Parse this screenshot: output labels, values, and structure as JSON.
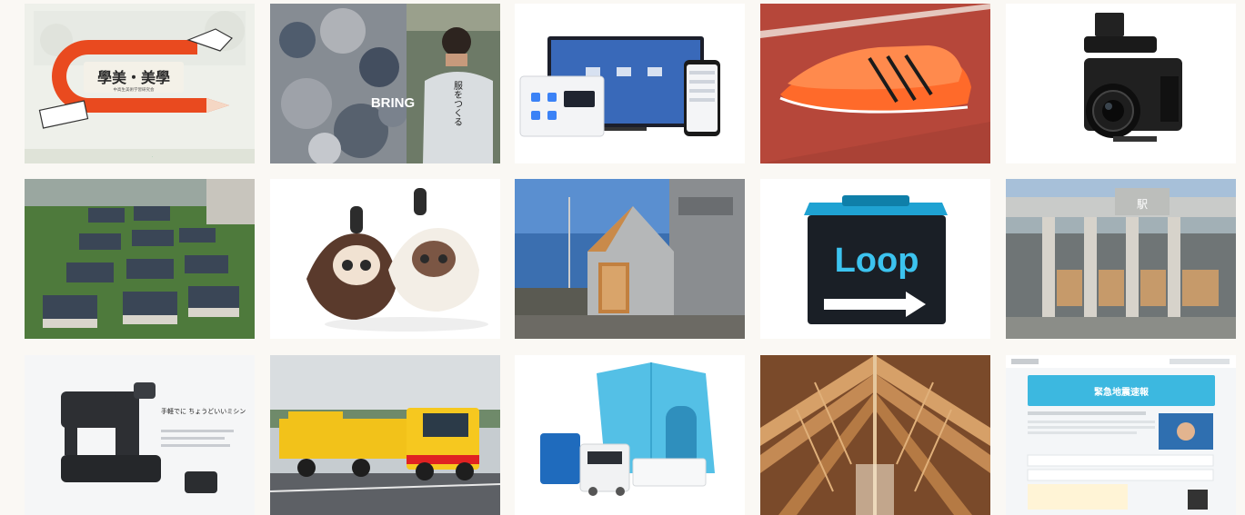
{
  "tiles": [
    {
      "id": "t1",
      "title": "學美・美學",
      "subtitle": "中高生美術学習研究会",
      "icon": "red-magnet-pencil-illustration"
    },
    {
      "id": "t2",
      "title": "BRING",
      "subtitle": "服をつくる",
      "icon": "clothing-recycling-poster"
    },
    {
      "id": "t3",
      "icon": "tv-tablet-phone-apps"
    },
    {
      "id": "t4",
      "icon": "orange-running-spike-shoes"
    },
    {
      "id": "t5",
      "icon": "cinema-camera"
    },
    {
      "id": "t6",
      "icon": "solar-roof-housing-aerial"
    },
    {
      "id": "t7",
      "icon": "lovot-home-robots"
    },
    {
      "id": "t8",
      "icon": "wooden-gabled-house"
    },
    {
      "id": "t9",
      "title": "Loop",
      "icon": "loop-delivery-tote"
    },
    {
      "id": "t10",
      "title": "駅",
      "icon": "train-station-building"
    },
    {
      "id": "t11",
      "title": "手軽でに ちょうどいいミシン",
      "icon": "sewing-machine"
    },
    {
      "id": "t12",
      "icon": "yellow-rail-truck"
    },
    {
      "id": "t13",
      "icon": "emergency-shelter-kit"
    },
    {
      "id": "t14",
      "icon": "timber-lattice-roof"
    },
    {
      "id": "t15",
      "title": "緊急地震速報",
      "icon": "earthquake-alert-webpage"
    }
  ],
  "colors": {
    "background": "#faf8f4",
    "accent_red": "#e94a1f",
    "accent_orange": "#ff6a2a",
    "track_red": "#b6473a",
    "loop_cyan": "#1fa2d2",
    "alert_blue": "#3cb8e0"
  }
}
